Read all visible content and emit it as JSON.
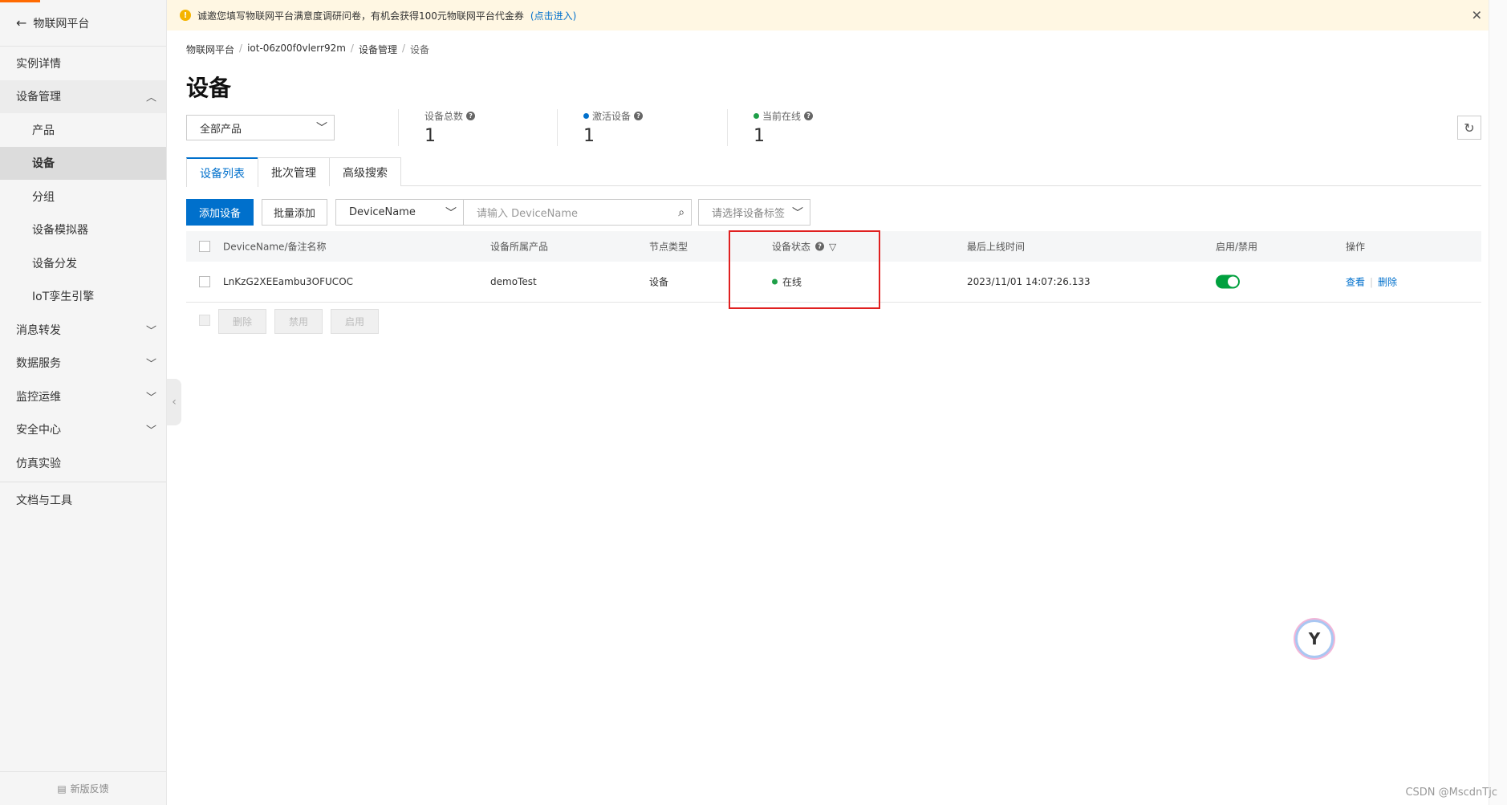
{
  "sidebar": {
    "back_label": "物联网平台",
    "items": [
      {
        "label": "实例详情"
      },
      {
        "label": "设备管理"
      },
      {
        "label": "产品"
      },
      {
        "label": "设备"
      },
      {
        "label": "分组"
      },
      {
        "label": "设备模拟器"
      },
      {
        "label": "设备分发"
      },
      {
        "label": "IoT孪生引擎"
      },
      {
        "label": "消息转发"
      },
      {
        "label": "数据服务"
      },
      {
        "label": "监控运维"
      },
      {
        "label": "安全中心"
      },
      {
        "label": "仿真实验"
      },
      {
        "label": "文档与工具"
      }
    ],
    "footer_label": "新版反馈"
  },
  "notice": {
    "text": "诚邀您填写物联网平台满意度调研问卷，有机会获得100元物联网平台代金券",
    "link": "(点击进入)"
  },
  "breadcrumb": [
    "物联网平台",
    "iot-06z00f0vlerr92m",
    "设备管理",
    "设备"
  ],
  "page_title": "设备",
  "product_select": "全部产品",
  "stats": [
    {
      "label": "设备总数",
      "value": "1",
      "dot_color": ""
    },
    {
      "label": "激活设备",
      "value": "1",
      "dot_color": "#0070cc"
    },
    {
      "label": "当前在线",
      "value": "1",
      "dot_color": "#1e9f48"
    }
  ],
  "tabs": [
    "设备列表",
    "批次管理",
    "高级搜索"
  ],
  "toolbar": {
    "add_device": "添加设备",
    "batch_add": "批量添加",
    "field_select": "DeviceName",
    "search_placeholder": "请输入 DeviceName",
    "tag_placeholder": "请选择设备标签"
  },
  "table": {
    "headers": [
      "DeviceName/备注名称",
      "设备所属产品",
      "节点类型",
      "设备状态",
      "最后上线时间",
      "启用/禁用",
      "操作"
    ],
    "rows": [
      {
        "device_name": "LnKzG2XEEambu3OFUCOC",
        "product": "demoTest",
        "node_type": "设备",
        "status": "在线",
        "last_online": "2023/11/01 14:07:26.133",
        "enabled": true,
        "actions": [
          "查看",
          "删除"
        ]
      }
    ]
  },
  "bulk_actions": [
    "删除",
    "禁用",
    "启用"
  ],
  "watermark": "CSDN @MscdnTjc",
  "colors": {
    "accent": "#0070cc",
    "online": "#1e9f48",
    "highlight": "#e02020"
  }
}
